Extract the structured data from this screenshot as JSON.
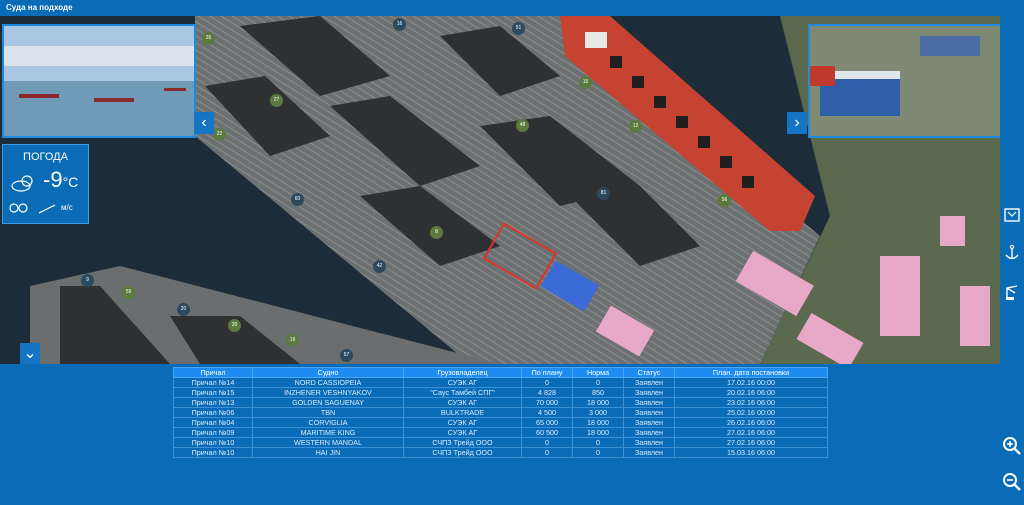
{
  "window": {
    "title": "Суда на подходе"
  },
  "weather": {
    "label": "ПОГОДА",
    "temperature": "-9",
    "temp_unit": "°C",
    "wind_unit": "м/с"
  },
  "map": {
    "markers": [
      "26",
      "16",
      "51",
      "27",
      "22",
      "60",
      "9",
      "59",
      "20",
      "19",
      "57",
      "48",
      "15",
      "42",
      "20",
      "12",
      "8",
      "56",
      "81"
    ]
  },
  "table": {
    "columns": [
      "Причал",
      "Судно",
      "Грузовладелец",
      "По плану",
      "Норма",
      "Статус",
      "План. дата постановки"
    ],
    "rows": [
      [
        "Причал №14",
        "NORD CASSIOPEIA",
        "СУЭК АГ",
        "0",
        "0",
        "Заявлен",
        "17.02.16 00:00"
      ],
      [
        "Причал №15",
        "INZHENER VESHNYAKOV",
        "\"Саус Тамбей СПГ\"",
        "4 828",
        "850",
        "Заявлен",
        "20.02.16 06:00"
      ],
      [
        "Причал №13",
        "GOLDEN SAGUENAY",
        "СУЭК АГ",
        "70 000",
        "18 000",
        "Заявлен",
        "23.02.16 06:00"
      ],
      [
        "Причал №06",
        "TBN",
        "BULKTRADE",
        "4 500",
        "3 000",
        "Заявлен",
        "25.02.16 00:00"
      ],
      [
        "Причал №04",
        "CORVIGLIA",
        "СУЭК АГ",
        "65 000",
        "18 000",
        "Заявлен",
        "26.02.16 06:00"
      ],
      [
        "Причал №09",
        "MARITIME KING",
        "СУЭК АГ",
        "60 500",
        "18 000",
        "Заявлен",
        "27.02.16 06:00"
      ],
      [
        "Причал №10",
        "WESTERN MANDAL",
        "СЧПЗ Трейд ООО",
        "0",
        "0",
        "Заявлен",
        "27.02.16 06:00"
      ],
      [
        "Причал №10",
        "HAI JIN",
        "СЧПЗ Трейд ООО",
        "0",
        "0",
        "Заявлен",
        "15.03.16 06:00"
      ]
    ]
  },
  "colors": {
    "accent": "#0a6bb6",
    "header": "#1e8bf2"
  }
}
